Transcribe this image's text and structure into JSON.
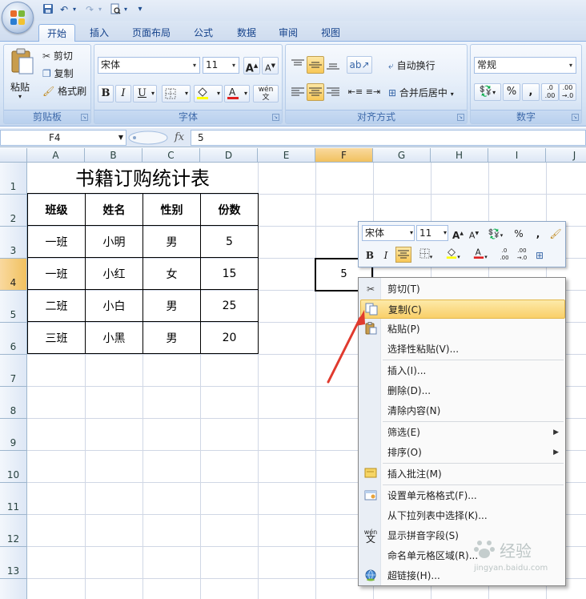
{
  "qat": {
    "undo_icon": "undo-icon",
    "redo_icon": "redo-icon",
    "save_icon": "save-icon",
    "preview_icon": "print-preview-icon",
    "more": "▾"
  },
  "tabs": [
    "开始",
    "插入",
    "页面布局",
    "公式",
    "数据",
    "审阅",
    "视图"
  ],
  "ribbon": {
    "clipboard": {
      "label": "剪贴板",
      "paste": "粘贴",
      "cut": "剪切",
      "copy": "复制",
      "format_painter": "格式刷"
    },
    "font": {
      "label": "字体",
      "font_name": "宋体",
      "font_size": "11",
      "bold": "B",
      "italic": "I",
      "underline": "U",
      "grow": "A",
      "shrink": "A",
      "phonetic": "wén\n文"
    },
    "alignment": {
      "label": "对齐方式",
      "wrap": "自动换行",
      "merge": "合并后居中"
    },
    "number": {
      "label": "数字",
      "format": "常规",
      "percent": "%",
      "comma": ",",
      "inc_decimal": ".0\n.00",
      "dec_decimal": ".00\n→.0"
    }
  },
  "formula_bar": {
    "name_box": "F4",
    "fx": "fx",
    "value": "5"
  },
  "columns": [
    "A",
    "B",
    "C",
    "D",
    "E",
    "F",
    "G",
    "H",
    "I",
    "J"
  ],
  "rows": [
    "1",
    "2",
    "3",
    "4",
    "5",
    "6",
    "7",
    "8",
    "9",
    "10",
    "11",
    "12",
    "13"
  ],
  "sheet": {
    "title": "书籍订购统计表",
    "headers": [
      "班级",
      "姓名",
      "性别",
      "份数"
    ],
    "data": [
      [
        "一班",
        "小明",
        "男",
        "5"
      ],
      [
        "一班",
        "小红",
        "女",
        "15"
      ],
      [
        "二班",
        "小白",
        "男",
        "25"
      ],
      [
        "三班",
        "小黑",
        "男",
        "20"
      ]
    ],
    "active_cell_value": "5"
  },
  "mini_toolbar": {
    "font_name": "宋体",
    "font_size": "11",
    "bold": "B",
    "italic": "I",
    "percent": "%",
    "comma": ","
  },
  "context_menu": [
    {
      "label": "剪切(T)",
      "icon": "scissors-icon"
    },
    {
      "label": "复制(C)",
      "icon": "copy-icon",
      "highlighted": true
    },
    {
      "label": "粘贴(P)",
      "icon": "paste-icon"
    },
    {
      "label": "选择性粘贴(V)...",
      "icon": ""
    },
    {
      "label": "插入(I)...",
      "icon": ""
    },
    {
      "label": "删除(D)...",
      "icon": ""
    },
    {
      "label": "清除内容(N)",
      "icon": ""
    },
    {
      "label": "筛选(E)",
      "icon": "",
      "submenu": true
    },
    {
      "label": "排序(O)",
      "icon": "",
      "submenu": true
    },
    {
      "label": "插入批注(M)",
      "icon": "comment-icon"
    },
    {
      "label": "设置单元格格式(F)...",
      "icon": "format-cells-icon"
    },
    {
      "label": "从下拉列表中选择(K)...",
      "icon": ""
    },
    {
      "label": "显示拼音字段(S)",
      "icon": "phonetic-icon"
    },
    {
      "label": "命名单元格区域(R)...",
      "icon": ""
    },
    {
      "label": "超链接(H)...",
      "icon": "hyperlink-icon"
    }
  ],
  "watermark": {
    "text": "经验",
    "subtext": "jingyan.baidu.com"
  },
  "colors": {
    "accent": "#f8c857",
    "ribbon": "#d6e4f5",
    "grid": "#d0d7e5",
    "annotation_arrow": "#e03a2e"
  }
}
